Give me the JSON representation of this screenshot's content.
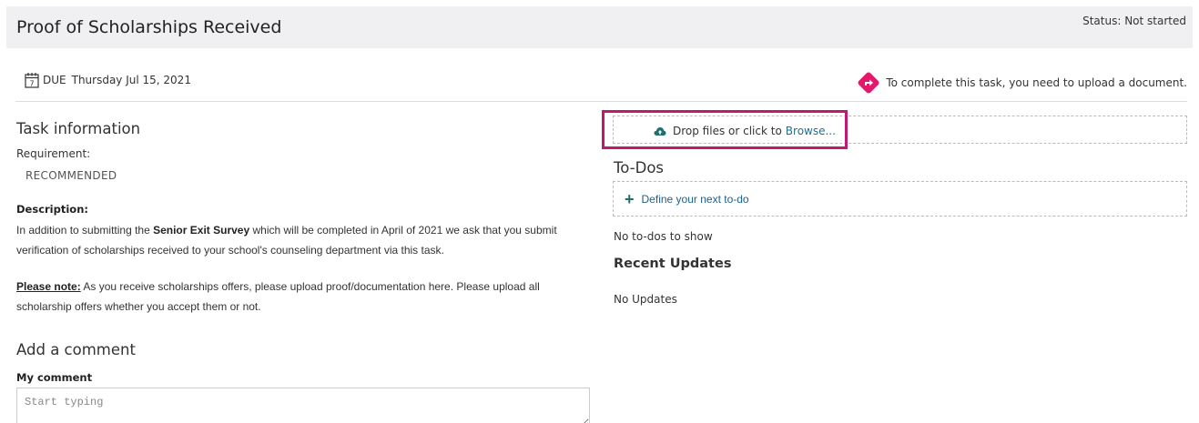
{
  "header": {
    "title": "Proof of Scholarships Received",
    "status": "Status: Not started"
  },
  "due": {
    "icon": "calendar-icon",
    "label": "DUE",
    "date": "Thursday Jul 15, 2021"
  },
  "upload_hint": {
    "icon": "diamond-arrow-icon",
    "text": "To complete this task, you need to upload a document.",
    "icon_color": "#e5196b"
  },
  "task_info": {
    "title": "Task information",
    "requirement_label": "Requirement:",
    "requirement_value": "RECOMMENDED",
    "description_label": "Description:",
    "desc_p1_before": "In addition to submitting the ",
    "desc_p1_bold": "Senior Exit Survey",
    "desc_p1_after": " which will be completed in April of 2021 we ask that you submit verification of scholarships received to your school's counseling department via this task.",
    "desc_p2_bold": "Please note:",
    "desc_p2_after": " As you receive scholarships offers, please upload proof/documentation here. Please upload all scholarship offers whether you accept them or not."
  },
  "comment": {
    "title": "Add a comment",
    "label": "My comment",
    "placeholder": "Start typing"
  },
  "dropzone": {
    "icon": "cloud-upload-icon",
    "text": "Drop files or click to",
    "browse_label": "Browse...",
    "highlight_color": "#c2186e"
  },
  "todos": {
    "title": "To-Dos",
    "add_label": "Define your next to-do",
    "empty_text": "No to-dos to show"
  },
  "recent_updates": {
    "title": "Recent Updates",
    "empty_text": "No Updates"
  }
}
